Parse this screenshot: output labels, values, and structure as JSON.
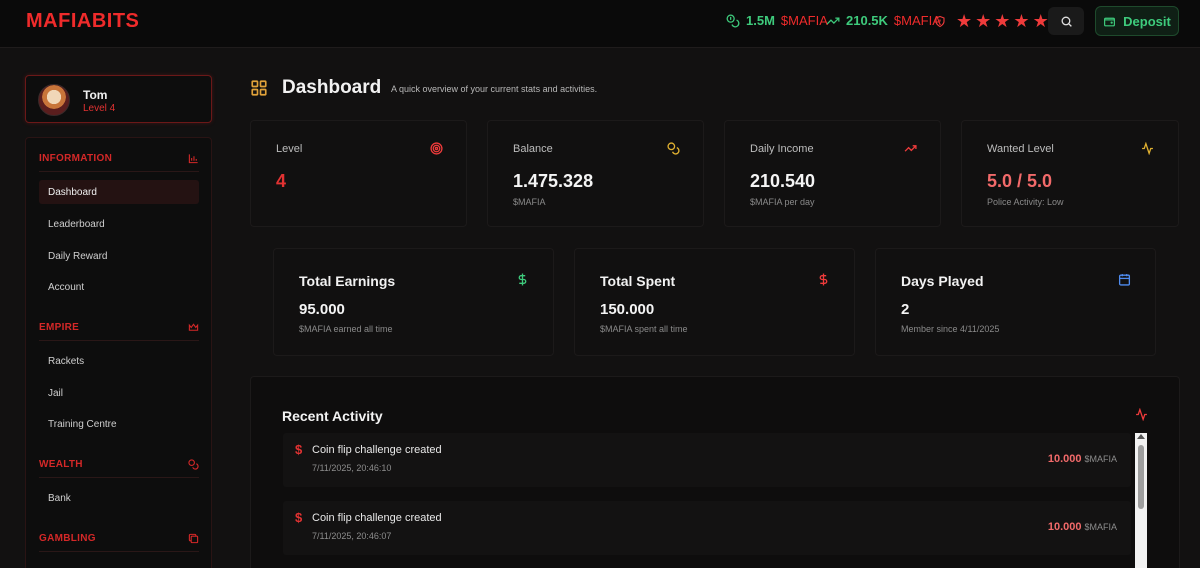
{
  "header": {
    "logo": "MAFIABITS",
    "balance_value": "1.5M",
    "balance_unit": "$MAFIA",
    "income_value": "210.5K",
    "income_unit": "$MAFIA",
    "wanted_stars": 5,
    "deposit_label": "Deposit",
    "colors": {
      "accent_red": "#ef2b2b",
      "accent_green": "#3ecb7c"
    }
  },
  "profile": {
    "name": "Tom",
    "level": "Level 4"
  },
  "sidebar": {
    "sections": [
      {
        "label": "INFORMATION",
        "icon": "bar-chart-icon",
        "items": [
          "Dashboard",
          "Leaderboard",
          "Daily Reward",
          "Account"
        ]
      },
      {
        "label": "EMPIRE",
        "icon": "crown-icon",
        "items": [
          "Rackets",
          "Jail",
          "Training Centre"
        ]
      },
      {
        "label": "WEALTH",
        "icon": "coins-icon",
        "items": [
          "Bank"
        ]
      },
      {
        "label": "GAMBLING",
        "icon": "dice-icon",
        "items": []
      }
    ],
    "active_item": "Dashboard"
  },
  "page": {
    "title": "Dashboard",
    "subtitle": "A quick overview of your current stats and activities."
  },
  "stats": [
    {
      "label": "Level",
      "value": "4",
      "sub": "",
      "icon": "target-icon"
    },
    {
      "label": "Balance",
      "value": "1.475.328",
      "sub": "$MAFIA",
      "icon": "coins-icon"
    },
    {
      "label": "Daily Income",
      "value": "210.540",
      "sub": "$MAFIA per day",
      "icon": "trending-up-icon"
    },
    {
      "label": "Wanted Level",
      "value": "5.0 / 5.0",
      "sub": "Police Activity: Low",
      "icon": "activity-icon"
    }
  ],
  "summary": [
    {
      "label": "Total Earnings",
      "value": "95.000",
      "sub": "$MAFIA earned all time",
      "icon": "dollar-icon"
    },
    {
      "label": "Total Spent",
      "value": "150.000",
      "sub": "$MAFIA spent all time",
      "icon": "dollar-icon"
    },
    {
      "label": "Days Played",
      "value": "2",
      "sub": "Member since 4/11/2025",
      "icon": "calendar-icon"
    }
  ],
  "activity": {
    "title": "Recent Activity",
    "items": [
      {
        "text": "Coin flip challenge created",
        "time": "7/11/2025, 20:46:10",
        "amount": "10.000",
        "unit": "$MAFIA"
      },
      {
        "text": "Coin flip challenge created",
        "time": "7/11/2025, 20:46:07",
        "amount": "10.000",
        "unit": "$MAFIA"
      }
    ]
  }
}
